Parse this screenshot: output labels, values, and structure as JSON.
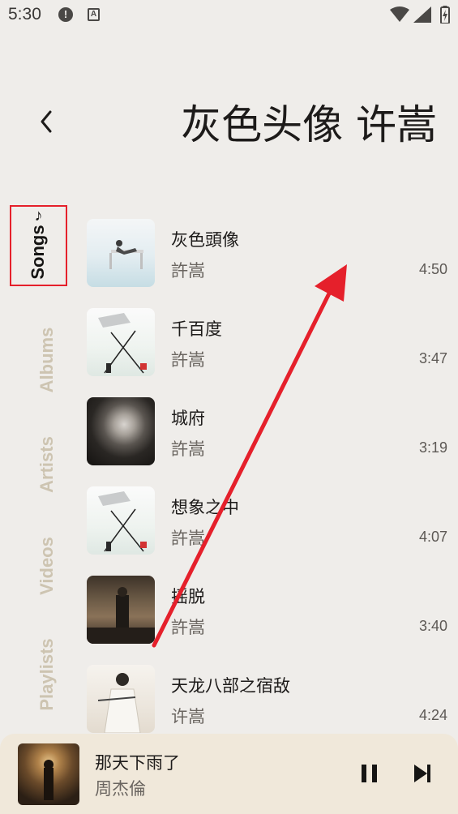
{
  "status_bar": {
    "time": "5:30",
    "icons": [
      "alert-icon",
      "text-a-icon",
      "wifi-icon",
      "signal-icon",
      "battery-icon"
    ],
    "alert_glyph": "!",
    "a_glyph": "A"
  },
  "header": {
    "title": "灰色头像 许嵩",
    "back_icon": "chevron-left-icon"
  },
  "tabs": [
    {
      "label": "Songs",
      "icon": "music-note-icon",
      "active": true
    },
    {
      "label": "Albums",
      "active": false
    },
    {
      "label": "Artists",
      "active": false
    },
    {
      "label": "Videos",
      "active": false
    },
    {
      "label": "Playlists",
      "active": false
    }
  ],
  "songs": [
    {
      "title": "灰色頭像",
      "artist": "許嵩",
      "duration": "4:50"
    },
    {
      "title": "千百度",
      "artist": "許嵩",
      "duration": "3:47"
    },
    {
      "title": "城府",
      "artist": "許嵩",
      "duration": "3:19"
    },
    {
      "title": "想象之中",
      "artist": "許嵩",
      "duration": "4:07"
    },
    {
      "title": "摇脱",
      "artist": "許嵩",
      "duration": "3:40"
    },
    {
      "title": "天龙八部之宿敌",
      "artist": "许嵩",
      "duration": "4:24"
    }
  ],
  "now_playing": {
    "title": "那天下雨了",
    "artist": "周杰倫",
    "pause_icon": "pause-icon",
    "next_icon": "skip-next-icon"
  },
  "colors": {
    "background": "#efedea",
    "player_background": "#f0e8da",
    "inactive_tab": "#cdc4b1",
    "annotation_red": "#e5202b"
  }
}
